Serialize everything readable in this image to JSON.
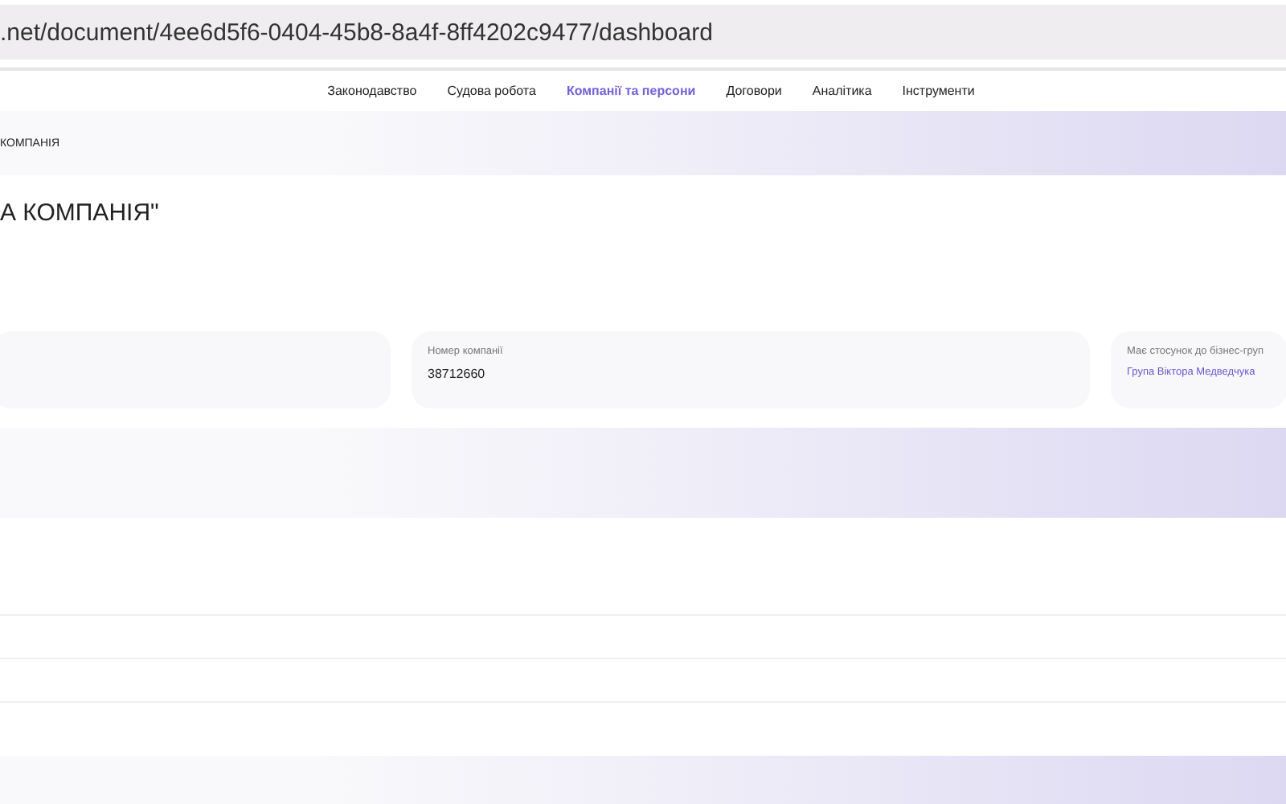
{
  "address_bar": {
    "url": ".net/document/4ee6d5f6-0404-45b8-8a4f-8ff4202c9477/dashboard"
  },
  "nav": {
    "items": [
      {
        "label": "Законодавство",
        "selected": false
      },
      {
        "label": "Судова робота",
        "selected": false
      },
      {
        "label": "Компанії та персони",
        "selected": true
      },
      {
        "label": "Договори",
        "selected": false
      },
      {
        "label": "Аналітика",
        "selected": false
      },
      {
        "label": "Інструменти",
        "selected": false
      }
    ]
  },
  "breadcrumb": "КОМПАНІЯ",
  "title": "А КОМПАНІЯ\"",
  "cards": [
    {
      "kind": "empty"
    },
    {
      "kind": "plain",
      "label": "Номер компанії",
      "value": "38712660"
    },
    {
      "kind": "link",
      "label": "Має стосунок до бізнес-груп",
      "value": "Група Віктора Медведчука"
    }
  ]
}
